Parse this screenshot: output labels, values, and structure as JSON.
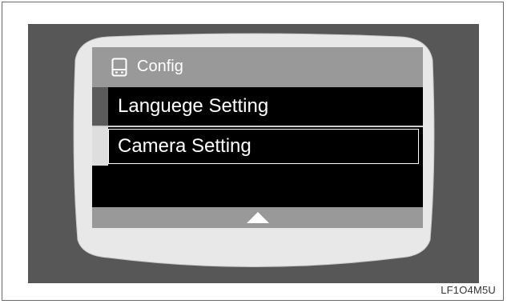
{
  "screen": {
    "title": "Config",
    "title_icon": "config-icon",
    "menu_items": [
      {
        "label": "Languege Setting",
        "selected": false
      },
      {
        "label": "Camera Setting",
        "selected": true
      }
    ],
    "scroll_icon": "up-arrow-icon"
  },
  "figure_code": "LF1O4M5U",
  "colors": {
    "panel": "#575757",
    "bezel": "#e6e6e6",
    "title_bar": "#999999",
    "screen_bg": "#000000"
  }
}
